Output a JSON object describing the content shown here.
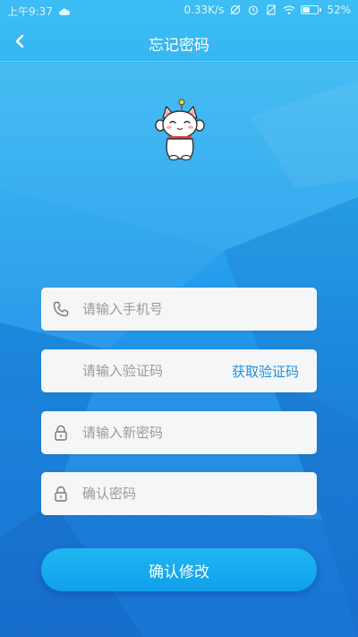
{
  "status_bar": {
    "time": "上午9:37",
    "network_speed": "0.33K/s",
    "battery_percent": "52%",
    "battery_level": 0.52,
    "icons": [
      "cloud-icon",
      "mute-icon",
      "alarm-icon",
      "no-sim-icon",
      "wifi-icon",
      "battery-icon"
    ]
  },
  "header": {
    "back_icon": "chevron-left-icon",
    "title": "忘记密码"
  },
  "mascot": {
    "icon": "lucky-cat-icon"
  },
  "form": {
    "phone": {
      "icon": "phone-icon",
      "placeholder": "请输入手机号",
      "value": ""
    },
    "code": {
      "placeholder": "请输入验证码",
      "value": "",
      "get_code_label": "获取验证码"
    },
    "new_password": {
      "icon": "lock-icon",
      "placeholder": "请输入新密码",
      "value": ""
    },
    "confirm_password": {
      "icon": "lock-icon",
      "placeholder": "确认密码",
      "value": ""
    },
    "submit_label": "确认修改"
  },
  "colors": {
    "accent": "#1f8fe2",
    "background_top": "#3cbdf3",
    "background_bottom": "#1e7fe0",
    "button": "#10a0ea"
  }
}
